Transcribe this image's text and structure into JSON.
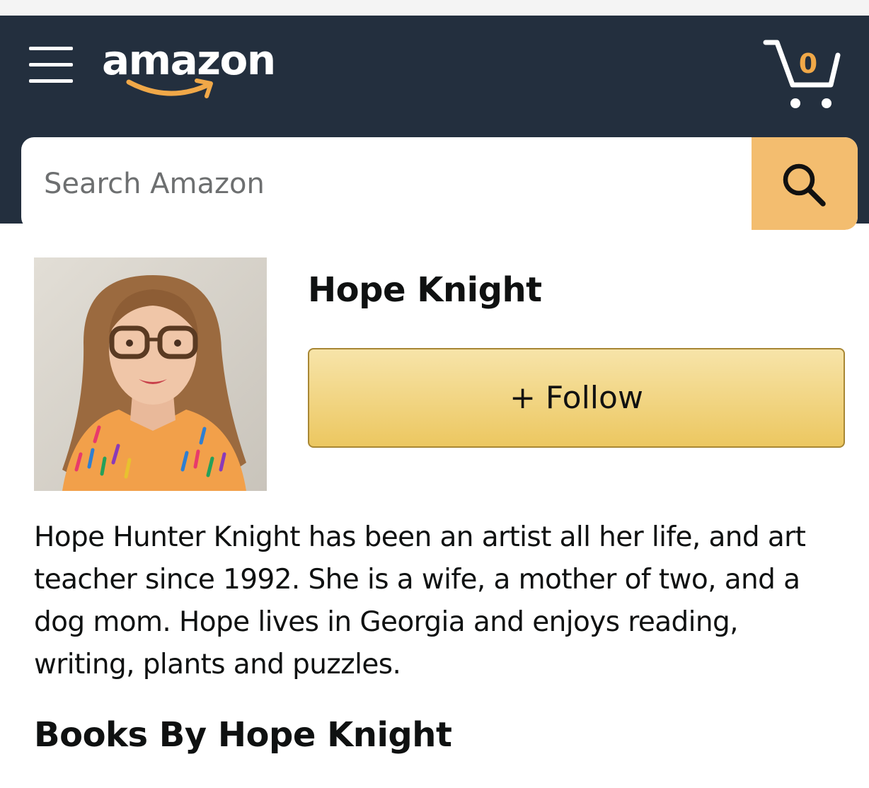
{
  "header": {
    "logo_text": "amazon",
    "cart_count": "0",
    "colors": {
      "background": "#232f3e",
      "accent": "#f0a848",
      "search_button": "#f3bd6f"
    }
  },
  "search": {
    "placeholder": "Search Amazon",
    "value": ""
  },
  "author": {
    "name": "Hope Knight",
    "follow_label": "+ Follow",
    "bio": "Hope Hunter Knight has been an artist all her life, and art teacher since 1992. She is a wife, a mother of two, and a dog mom. Hope lives in Georgia and enjoys reading, writing, plants and puzzles."
  },
  "books_section": {
    "title": "Books By Hope Knight"
  },
  "icons": [
    "menu-icon",
    "amazon-logo",
    "cart-icon",
    "search-icon"
  ]
}
